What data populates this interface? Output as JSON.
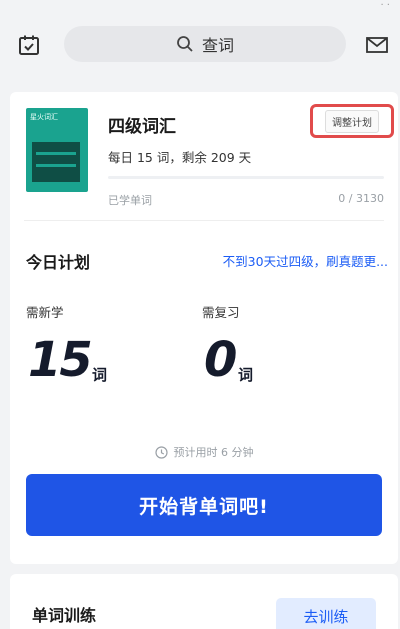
{
  "header": {
    "status_fragment": "· ·",
    "search_label": "查词"
  },
  "book": {
    "cover_tag": "星火词汇",
    "title": "四级词汇",
    "plan_info": "每日 15 词，剩余 209 天",
    "adjust_label": "调整计划",
    "learned_label": "已学单词",
    "learned_count": "0 / 3130",
    "progress_fraction": 0
  },
  "today": {
    "title": "今日计划",
    "promo": "不到30天过四级，刷真题更...",
    "new_label": "需新学",
    "new_count": "15",
    "new_unit": "词",
    "review_label": "需复习",
    "review_count": "0",
    "review_unit": "词",
    "time_estimate": "预计用时 6 分钟",
    "start_label": "开始背单词吧!"
  },
  "training": {
    "title": "单词训练",
    "button_label": "去训练"
  },
  "colors": {
    "accent": "#1f55e6",
    "link": "#1b5cf5",
    "highlight_border": "#e14b4b",
    "cover": "#1aa38f"
  },
  "icons": {
    "top_left": "calendar-check-icon",
    "search": "search-icon",
    "top_right": "mail-icon",
    "time": "clock-icon"
  }
}
